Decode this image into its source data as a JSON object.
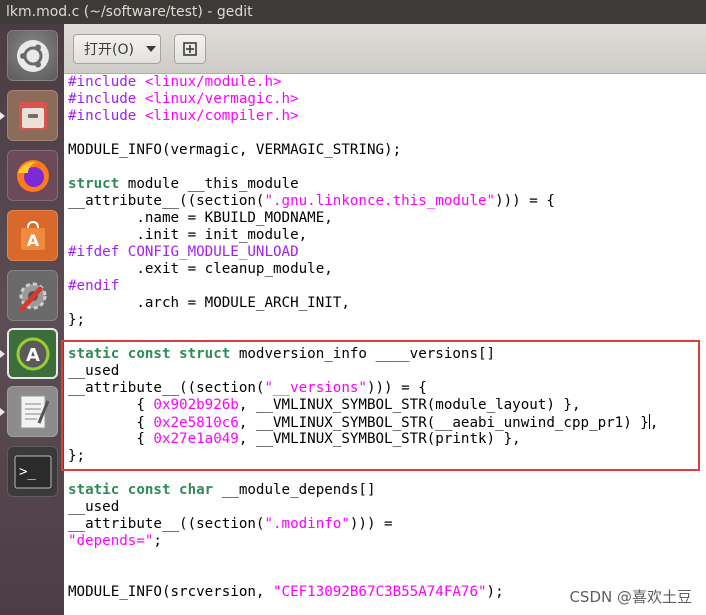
{
  "window": {
    "title": "lkm.mod.c (~/software/test) - gedit"
  },
  "toolbar": {
    "open_label": "打开(O)"
  },
  "launcher": {
    "items": [
      {
        "name": "dash-home",
        "icon": "ubuntu-logo-icon"
      },
      {
        "name": "files",
        "icon": "file-cabinet-icon"
      },
      {
        "name": "firefox",
        "icon": "firefox-icon"
      },
      {
        "name": "software-center",
        "icon": "shopping-bag-icon"
      },
      {
        "name": "system-settings",
        "icon": "wrench-gear-icon"
      },
      {
        "name": "software-updater",
        "icon": "updater-icon"
      },
      {
        "name": "text-editor",
        "icon": "text-editor-icon"
      },
      {
        "name": "terminal",
        "icon": "terminal-icon"
      }
    ]
  },
  "code": {
    "lines": [
      [
        [
          "pp",
          "#include "
        ],
        [
          "str",
          "<linux/module.h>"
        ]
      ],
      [
        [
          "pp",
          "#include "
        ],
        [
          "str",
          "<linux/vermagic.h>"
        ]
      ],
      [
        [
          "pp",
          "#include "
        ],
        [
          "str",
          "<linux/compiler.h>"
        ]
      ],
      [
        [
          "",
          ""
        ]
      ],
      [
        [
          "",
          "MODULE_INFO(vermagic, VERMAGIC_STRING);"
        ]
      ],
      [
        [
          "",
          ""
        ]
      ],
      [
        [
          "type",
          "struct"
        ],
        [
          "",
          " module __this_module"
        ]
      ],
      [
        [
          "",
          "__attribute__((section("
        ],
        [
          "str",
          "\".gnu.linkonce.this_module\""
        ],
        [
          "",
          ")))"
        ],
        [
          "",
          " = {"
        ]
      ],
      [
        [
          "",
          "        .name = KBUILD_MODNAME,"
        ]
      ],
      [
        [
          "",
          "        .init = init_module,"
        ]
      ],
      [
        [
          "pp",
          "#ifdef CONFIG_MODULE_UNLOAD"
        ]
      ],
      [
        [
          "",
          "        .exit = cleanup_module,"
        ]
      ],
      [
        [
          "pp",
          "#endif"
        ]
      ],
      [
        [
          "",
          "        .arch = MODULE_ARCH_INIT,"
        ]
      ],
      [
        [
          "",
          "};"
        ]
      ],
      [
        [
          "",
          ""
        ]
      ],
      [
        [
          "type",
          "static const struct"
        ],
        [
          "",
          " modversion_info ____versions[]"
        ]
      ],
      [
        [
          "",
          "__used"
        ]
      ],
      [
        [
          "",
          "__attribute__((section("
        ],
        [
          "str",
          "\"__versions\""
        ],
        [
          "",
          ")))"
        ],
        [
          "",
          " = {"
        ]
      ],
      [
        [
          "",
          "        { "
        ],
        [
          "num",
          "0x902b926b"
        ],
        [
          "",
          ", __VMLINUX_SYMBOL_STR(module_layout) },"
        ]
      ],
      [
        [
          "",
          "        { "
        ],
        [
          "num",
          "0x2e5810c6"
        ],
        [
          "",
          ", __VMLINUX_SYMBOL_STR(__aeabi_unwind_cpp_pr1) }"
        ],
        [
          "cursor",
          ""
        ],
        [
          "",
          ","
        ]
      ],
      [
        [
          "",
          "        { "
        ],
        [
          "num",
          "0x27e1a049"
        ],
        [
          "",
          ", __VMLINUX_SYMBOL_STR(printk) },"
        ]
      ],
      [
        [
          "",
          "};"
        ]
      ],
      [
        [
          "",
          ""
        ]
      ],
      [
        [
          "type",
          "static const char"
        ],
        [
          "",
          " __module_depends[]"
        ]
      ],
      [
        [
          "",
          "__used"
        ]
      ],
      [
        [
          "",
          "__attribute__((section("
        ],
        [
          "str",
          "\".modinfo\""
        ],
        [
          "",
          ")))"
        ],
        [
          "",
          " ="
        ]
      ],
      [
        [
          "str",
          "\"depends=\""
        ],
        [
          "",
          ";"
        ]
      ],
      [
        [
          "",
          ""
        ]
      ],
      [
        [
          "",
          ""
        ]
      ],
      [
        [
          "",
          "MODULE_INFO(srcversion, "
        ],
        [
          "str",
          "\"CEF13092B67C3B55A74FA76\""
        ],
        [
          "",
          ");"
        ]
      ]
    ]
  },
  "watermark": "CSDN @喜欢土豆",
  "colors": {
    "highlight_box": "#e03c3c",
    "string": "#ff00ff",
    "preproc": "#a020f0",
    "type": "#2e8b57"
  }
}
